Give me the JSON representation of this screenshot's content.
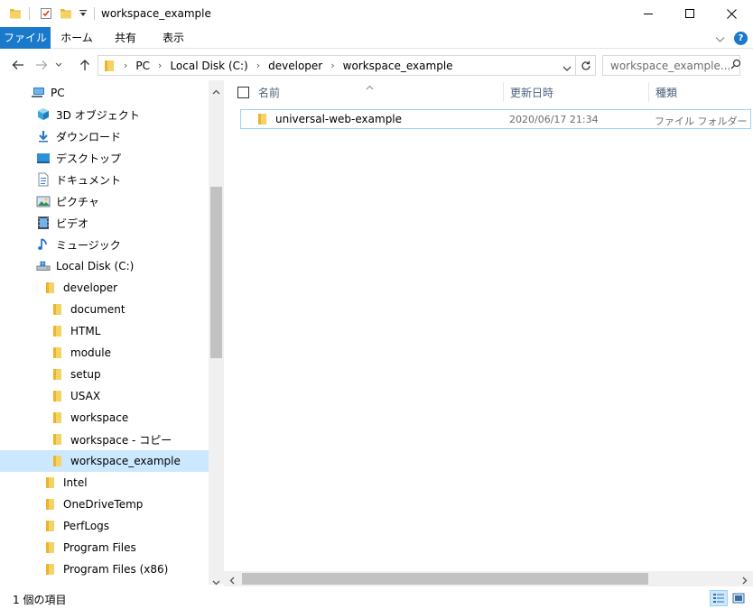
{
  "window": {
    "title": "workspace_example"
  },
  "ribbon": {
    "tabs": [
      "ファイル",
      "ホーム",
      "共有",
      "表示"
    ]
  },
  "address": {
    "crumbs": [
      "PC",
      "Local Disk (C:)",
      "developer",
      "workspace_example"
    ]
  },
  "search": {
    "placeholder": "workspace_example..."
  },
  "nav_tree": [
    {
      "label": "PC",
      "icon": "pc-icon",
      "indent": 1
    },
    {
      "label": "3D オブジェクト",
      "icon": "3d-objects-icon",
      "indent": 2
    },
    {
      "label": "ダウンロード",
      "icon": "download-icon",
      "indent": 2
    },
    {
      "label": "デスクトップ",
      "icon": "desktop-icon",
      "indent": 2
    },
    {
      "label": "ドキュメント",
      "icon": "documents-icon",
      "indent": 2
    },
    {
      "label": "ピクチャ",
      "icon": "pictures-icon",
      "indent": 2
    },
    {
      "label": "ビデオ",
      "icon": "video-icon",
      "indent": 2
    },
    {
      "label": "ミュージック",
      "icon": "music-icon",
      "indent": 2
    },
    {
      "label": "Local Disk (C:)",
      "icon": "drive-icon",
      "indent": 2
    },
    {
      "label": "developer",
      "icon": "folder-icon",
      "indent": 3
    },
    {
      "label": "document",
      "icon": "folder-icon",
      "indent": 4
    },
    {
      "label": "HTML",
      "icon": "folder-icon",
      "indent": 4
    },
    {
      "label": "module",
      "icon": "folder-icon",
      "indent": 4
    },
    {
      "label": "setup",
      "icon": "folder-icon",
      "indent": 4
    },
    {
      "label": "USAX",
      "icon": "folder-icon",
      "indent": 4
    },
    {
      "label": "workspace",
      "icon": "folder-icon",
      "indent": 4
    },
    {
      "label": "workspace - コピー",
      "icon": "folder-icon",
      "indent": 4
    },
    {
      "label": "workspace_example",
      "icon": "folder-icon",
      "indent": 4,
      "selected": true
    },
    {
      "label": "Intel",
      "icon": "folder-icon",
      "indent": 3
    },
    {
      "label": "OneDriveTemp",
      "icon": "folder-icon",
      "indent": 3
    },
    {
      "label": "PerfLogs",
      "icon": "folder-icon",
      "indent": 3
    },
    {
      "label": "Program Files",
      "icon": "folder-icon",
      "indent": 3
    },
    {
      "label": "Program Files (x86)",
      "icon": "folder-icon",
      "indent": 3
    }
  ],
  "columns": {
    "name": "名前",
    "modified": "更新日時",
    "type": "種類"
  },
  "files": [
    {
      "name": "universal-web-example",
      "modified": "2020/06/17 21:34",
      "type": "ファイル フォルダー"
    }
  ],
  "status": {
    "item_count": "1 個の項目"
  },
  "colors": {
    "accent": "#1979ca",
    "folder": "#e8b530",
    "selection": "#cce8ff",
    "selection_border": "#99d1ff"
  }
}
